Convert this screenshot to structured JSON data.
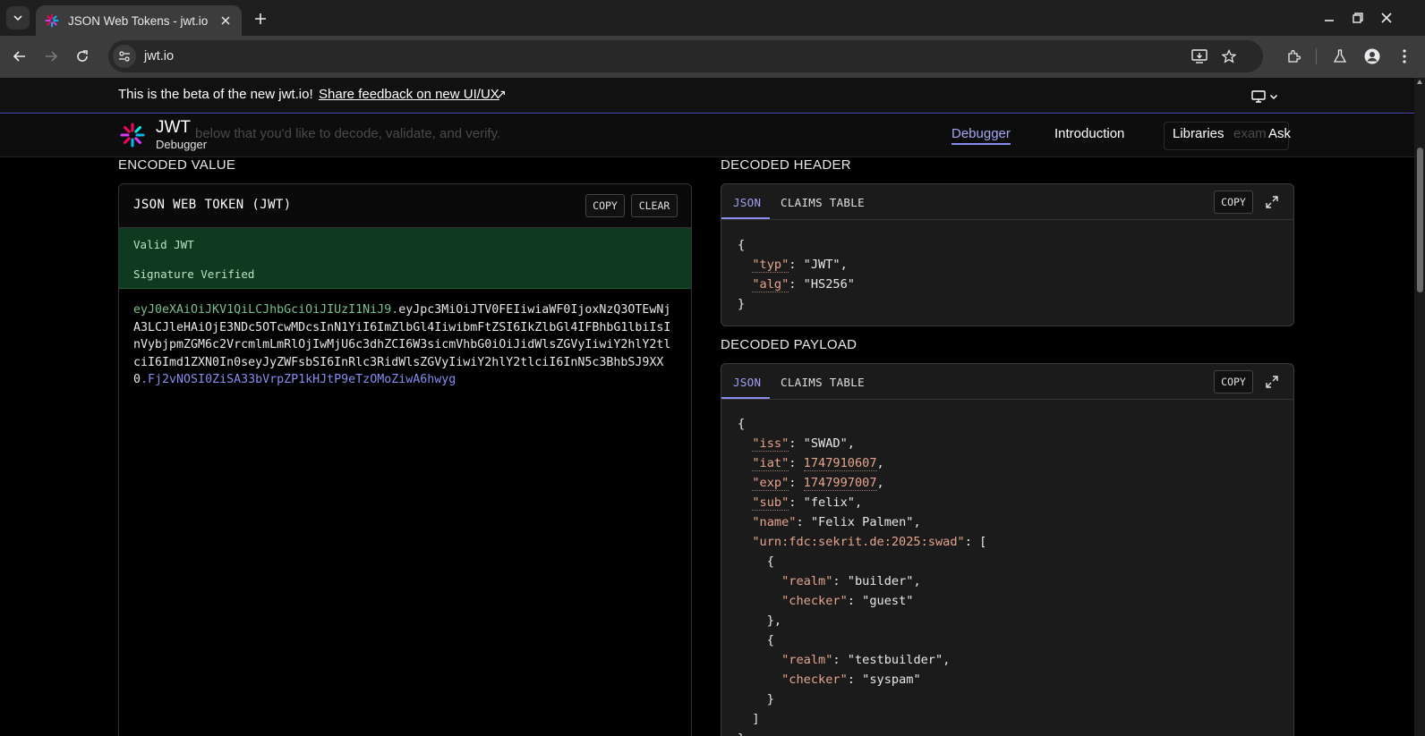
{
  "browser": {
    "tab_title": "JSON Web Tokens - jwt.io",
    "url": "jwt.io"
  },
  "banner": {
    "text": "This is the beta of the new jwt.io!",
    "link": "Share feedback on new UI/UX"
  },
  "header": {
    "logo_title": "JWT",
    "logo_subtitle": "Debugger",
    "ghost_text": "below that you'd like to decode, validate, and verify.",
    "ghost_example": "exam",
    "nav": [
      "Debugger",
      "Introduction",
      "Libraries",
      "Ask"
    ]
  },
  "encoded": {
    "section_title": "ENCODED VALUE",
    "panel_title": "JSON WEB TOKEN (JWT)",
    "copy_label": "COPY",
    "clear_label": "CLEAR",
    "status_valid": "Valid JWT",
    "status_signature": "Signature Verified",
    "token_header": "eyJ0eXAiOiJKV1QiLCJhbGciOiJIUzI1NiJ9.",
    "token_payload": "eyJpc3MiOiJTV0FEIiwiaWF0IjoxNzQ3OTEwNjA3LCJleHAiOjE3NDc5OTcwMDcsInN1YiI6ImZlbGl4IiwibmFtZSI6IkZlbGl4IFBhbG1lbiIsInVybjpmZGM6c2VrcmlmLmRlOjIwMjU6c3dhZCI6W3sicmVhbG0iOiJidWlsZGVyIiwiY2hlY2tlciI6Imd1ZXN0In0seyJyZWFsbSI6InRlc3RidWlsZGVyIiwiY2hlY2tlciI6InN5c3BhbSJ9XX0",
    "token_signature": ".Fj2vNOSI0ZiSA33bVrpZP1kHJtP9eTzOMoZiwA6hwyg"
  },
  "decoded_header": {
    "section_title": "DECODED HEADER",
    "tab_json": "JSON",
    "tab_claims": "CLAIMS TABLE",
    "copy_label": "COPY",
    "lines": [
      {
        "indent": 0,
        "text": "{"
      },
      {
        "indent": 1,
        "key": "typ",
        "value": "\"JWT\"",
        "comma": true
      },
      {
        "indent": 1,
        "key": "alg",
        "value": "\"HS256\"",
        "comma": false
      },
      {
        "indent": 0,
        "text": "}"
      }
    ]
  },
  "decoded_payload": {
    "section_title": "DECODED PAYLOAD",
    "tab_json": "JSON",
    "tab_claims": "CLAIMS TABLE",
    "copy_label": "COPY",
    "lines": [
      {
        "indent": 0,
        "text": "{"
      },
      {
        "indent": 1,
        "key": "iss",
        "value": "\"SWAD\"",
        "comma": true
      },
      {
        "indent": 1,
        "key": "iat",
        "num": "1747910607",
        "comma": true
      },
      {
        "indent": 1,
        "key": "exp",
        "num": "1747997007",
        "comma": true
      },
      {
        "indent": 1,
        "key": "sub",
        "value": "\"felix\"",
        "comma": true
      },
      {
        "indent": 1,
        "key": "name",
        "plain": true,
        "value": "\"Felix Palmen\"",
        "comma": true
      },
      {
        "indent": 1,
        "key": "urn:fdc:sekrit.de:2025:swad",
        "plain": true,
        "value": "[",
        "comma": false
      },
      {
        "indent": 2,
        "text": "{"
      },
      {
        "indent": 3,
        "key": "realm",
        "plain": true,
        "value": "\"builder\"",
        "comma": true
      },
      {
        "indent": 3,
        "key": "checker",
        "plain": true,
        "value": "\"guest\"",
        "comma": false
      },
      {
        "indent": 2,
        "text": "},"
      },
      {
        "indent": 2,
        "text": "{"
      },
      {
        "indent": 3,
        "key": "realm",
        "plain": true,
        "value": "\"testbuilder\"",
        "comma": true
      },
      {
        "indent": 3,
        "key": "checker",
        "plain": true,
        "value": "\"syspam\"",
        "comma": false
      },
      {
        "indent": 2,
        "text": "}"
      },
      {
        "indent": 1,
        "text": "]"
      },
      {
        "indent": 0,
        "text": "}"
      }
    ]
  }
}
